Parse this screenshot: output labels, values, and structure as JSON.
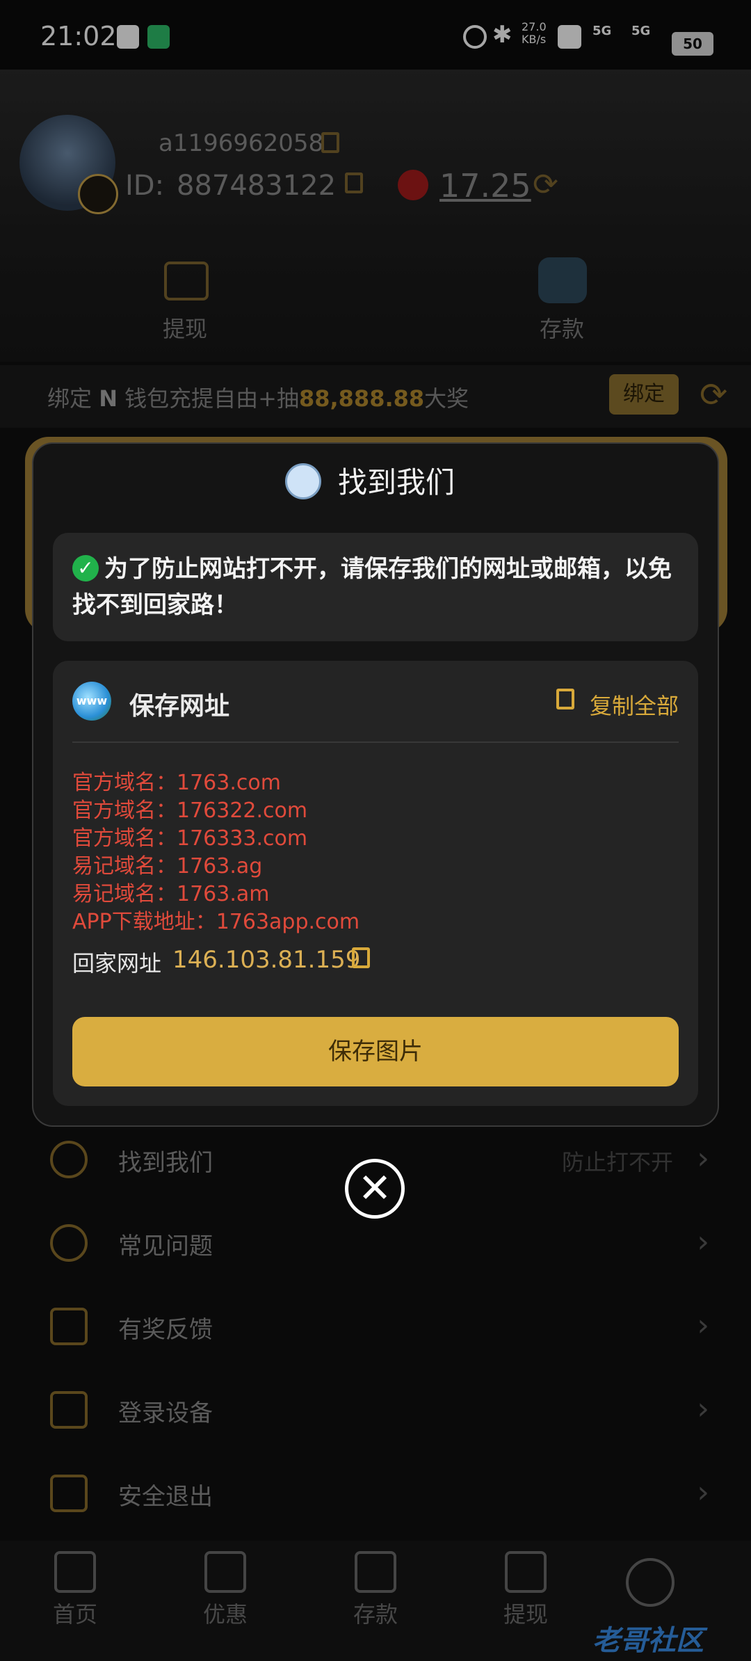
{
  "status_bar": {
    "time": "21:02",
    "network_speed": "27.0\nKB/s",
    "signal_1": "5G",
    "signal_2": "5G",
    "battery": "50"
  },
  "profile": {
    "username": "a1196962058",
    "id_label": "ID:",
    "id_value": "887483122",
    "balance": "17.25"
  },
  "quick_actions": [
    {
      "label": "提现",
      "icon": "ticket-icon"
    },
    {
      "label": "存款",
      "icon": "wallet-icon"
    }
  ],
  "promo": {
    "text_before": "绑定 ",
    "brand": "N",
    "text_mid": " 钱包充提自由+抽",
    "amount": "88,888.88",
    "text_after": "大奖",
    "bind_label": "绑定"
  },
  "menu": [
    {
      "label": "找到我们",
      "hint": "防止打不开",
      "icon": "search-icon"
    },
    {
      "label": "常见问题",
      "hint": "",
      "icon": "question-icon"
    },
    {
      "label": "有奖反馈",
      "hint": "",
      "icon": "edit-icon"
    },
    {
      "label": "登录设备",
      "hint": "",
      "icon": "devices-icon"
    },
    {
      "label": "安全退出",
      "hint": "",
      "icon": "logout-icon"
    }
  ],
  "tabbar": [
    {
      "label": "首页",
      "icon": "home-icon"
    },
    {
      "label": "优惠",
      "icon": "gift-icon"
    },
    {
      "label": "存款",
      "icon": "wallet-icon"
    },
    {
      "label": "提现",
      "icon": "ticket-icon"
    }
  ],
  "watermark": "老哥社区",
  "modal": {
    "title": "找到我们",
    "notice": "为了防止网站打不开，请保存我们的网址或邮箱，以免找不到回家路！",
    "card_title": "保存网址",
    "copy_all": "复制全部",
    "domains": [
      "官方域名：1763.com",
      "官方域名：176322.com",
      "官方域名：176333.com",
      "易记域名：1763.ag",
      "易记域名：1763.am",
      "APP下载地址：1763app.com"
    ],
    "home_label": "回家网址",
    "home_ip": "146.103.81.159",
    "save_button": "保存图片",
    "close_symbol": "✕"
  },
  "colors": {
    "accent_gold": "#d9ad40",
    "domain_red": "#e04a3b",
    "background": "#101010"
  }
}
